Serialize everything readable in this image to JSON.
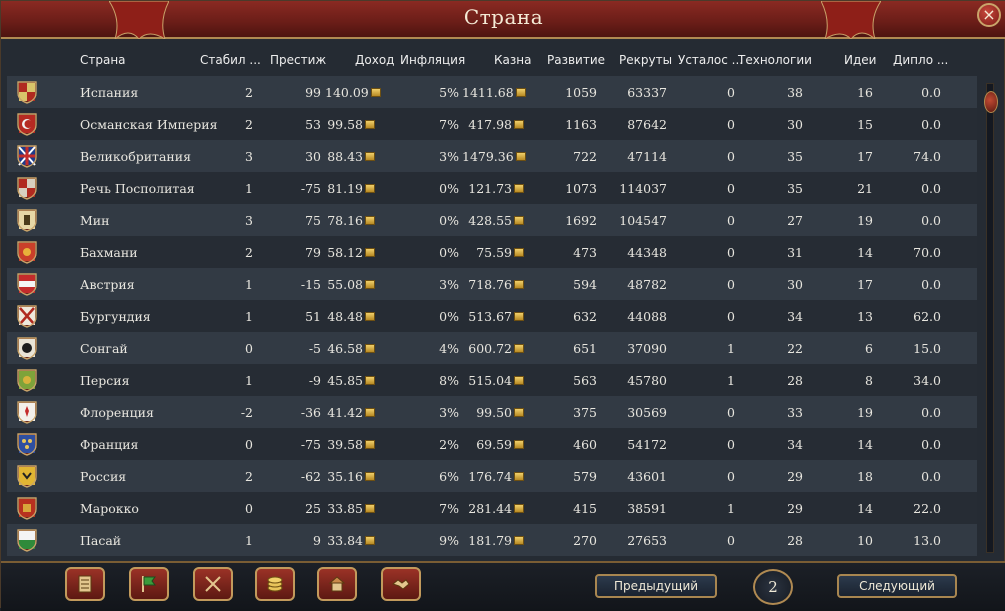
{
  "window": {
    "title": "Страна",
    "close_label": "×"
  },
  "columns": {
    "country": "Страна",
    "stability": "Стабил ...",
    "prestige": "Престиж",
    "income": "Доход",
    "inflation": "Инфляция",
    "treasury": "Казна",
    "development": "Развитие",
    "manpower": "Рекруты",
    "war_exhaustion": "Усталос ...",
    "technology": "Технологии",
    "ideas": "Идеи",
    "diplo": "Дипло ..."
  },
  "rows": [
    {
      "country": "Испания",
      "stability": "2",
      "prestige": "99",
      "income": "140.09",
      "inflation": "5%",
      "treasury": "1411.68",
      "development": "1059",
      "manpower": "63337",
      "war_exhaustion": "0",
      "technology": "38",
      "ideas": "16",
      "diplo": "0.0",
      "flag": "spain-flag-icon"
    },
    {
      "country": "Османская Империя",
      "stability": "2",
      "prestige": "53",
      "income": "99.58",
      "inflation": "7%",
      "treasury": "417.98",
      "development": "1163",
      "manpower": "87642",
      "war_exhaustion": "0",
      "technology": "30",
      "ideas": "15",
      "diplo": "0.0",
      "flag": "ottoman-flag-icon"
    },
    {
      "country": "Великобритания",
      "stability": "3",
      "prestige": "30",
      "income": "88.43",
      "inflation": "3%",
      "treasury": "1479.36",
      "development": "722",
      "manpower": "47114",
      "war_exhaustion": "0",
      "technology": "35",
      "ideas": "17",
      "diplo": "74.0",
      "flag": "britain-flag-icon"
    },
    {
      "country": "Речь Посполитая",
      "stability": "1",
      "prestige": "-75",
      "income": "81.19",
      "inflation": "0%",
      "treasury": "121.73",
      "development": "1073",
      "manpower": "114037",
      "war_exhaustion": "0",
      "technology": "35",
      "ideas": "21",
      "diplo": "0.0",
      "flag": "commonwealth-flag-icon"
    },
    {
      "country": "Мин",
      "stability": "3",
      "prestige": "75",
      "income": "78.16",
      "inflation": "0%",
      "treasury": "428.55",
      "development": "1692",
      "manpower": "104547",
      "war_exhaustion": "0",
      "technology": "27",
      "ideas": "19",
      "diplo": "0.0",
      "flag": "ming-flag-icon"
    },
    {
      "country": "Бахмани",
      "stability": "2",
      "prestige": "79",
      "income": "58.12",
      "inflation": "0%",
      "treasury": "75.59",
      "development": "473",
      "manpower": "44348",
      "war_exhaustion": "0",
      "technology": "31",
      "ideas": "14",
      "diplo": "70.0",
      "flag": "bahmanis-flag-icon"
    },
    {
      "country": "Австрия",
      "stability": "1",
      "prestige": "-15",
      "income": "55.08",
      "inflation": "3%",
      "treasury": "718.76",
      "development": "594",
      "manpower": "48782",
      "war_exhaustion": "0",
      "technology": "30",
      "ideas": "17",
      "diplo": "0.0",
      "flag": "austria-flag-icon"
    },
    {
      "country": "Бургундия",
      "stability": "1",
      "prestige": "51",
      "income": "48.48",
      "inflation": "0%",
      "treasury": "513.67",
      "development": "632",
      "manpower": "44088",
      "war_exhaustion": "0",
      "technology": "34",
      "ideas": "13",
      "diplo": "62.0",
      "flag": "burgundy-flag-icon"
    },
    {
      "country": "Сонгай",
      "stability": "0",
      "prestige": "-5",
      "income": "46.58",
      "inflation": "4%",
      "treasury": "600.72",
      "development": "651",
      "manpower": "37090",
      "war_exhaustion": "1",
      "technology": "22",
      "ideas": "6",
      "diplo": "15.0",
      "flag": "songhai-flag-icon"
    },
    {
      "country": "Персия",
      "stability": "1",
      "prestige": "-9",
      "income": "45.85",
      "inflation": "8%",
      "treasury": "515.04",
      "development": "563",
      "manpower": "45780",
      "war_exhaustion": "1",
      "technology": "28",
      "ideas": "8",
      "diplo": "34.0",
      "flag": "persia-flag-icon"
    },
    {
      "country": "Флоренция",
      "stability": "-2",
      "prestige": "-36",
      "income": "41.42",
      "inflation": "3%",
      "treasury": "99.50",
      "development": "375",
      "manpower": "30569",
      "war_exhaustion": "0",
      "technology": "33",
      "ideas": "19",
      "diplo": "0.0",
      "flag": "florence-flag-icon"
    },
    {
      "country": "Франция",
      "stability": "0",
      "prestige": "-75",
      "income": "39.58",
      "inflation": "2%",
      "treasury": "69.59",
      "development": "460",
      "manpower": "54172",
      "war_exhaustion": "0",
      "technology": "34",
      "ideas": "14",
      "diplo": "0.0",
      "flag": "france-flag-icon"
    },
    {
      "country": "Россия",
      "stability": "2",
      "prestige": "-62",
      "income": "35.16",
      "inflation": "6%",
      "treasury": "176.74",
      "development": "579",
      "manpower": "43601",
      "war_exhaustion": "0",
      "technology": "29",
      "ideas": "18",
      "diplo": "0.0",
      "flag": "russia-flag-icon"
    },
    {
      "country": "Марокко",
      "stability": "0",
      "prestige": "25",
      "income": "33.85",
      "inflation": "7%",
      "treasury": "281.44",
      "development": "415",
      "manpower": "38591",
      "war_exhaustion": "1",
      "technology": "29",
      "ideas": "14",
      "diplo": "22.0",
      "flag": "morocco-flag-icon"
    },
    {
      "country": "Пасай",
      "stability": "1",
      "prestige": "9",
      "income": "33.84",
      "inflation": "9%",
      "treasury": "181.79",
      "development": "270",
      "manpower": "27653",
      "war_exhaustion": "0",
      "technology": "28",
      "ideas": "10",
      "diplo": "13.0",
      "flag": "pasai-flag-icon"
    }
  ],
  "toolbar": {
    "icons": [
      "ledger-icon",
      "flag-icon",
      "crossed-swords-icon",
      "coins-icon",
      "building-icon",
      "handshake-icon"
    ]
  },
  "pagination": {
    "prev_label": "Предыдущий",
    "next_label": "Следующий",
    "page": "2"
  },
  "colors": {
    "title_bar": "#7a2219",
    "gold_trim": "#b08a52",
    "row_odd": "#323a44",
    "row_even": "#262c34"
  }
}
